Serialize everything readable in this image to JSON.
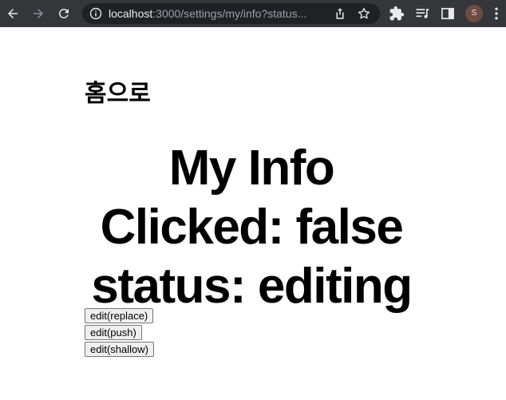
{
  "browser": {
    "url_host": "localhost",
    "url_rest": ":3000/settings/my/info?status...",
    "profile_initial": "S"
  },
  "page": {
    "home_link": "홈으로",
    "heading_lines": [
      "My Info",
      "Clicked: false",
      "status: editing"
    ],
    "buttons": [
      "edit(replace)",
      "edit(push)",
      "edit(shallow)"
    ]
  }
}
